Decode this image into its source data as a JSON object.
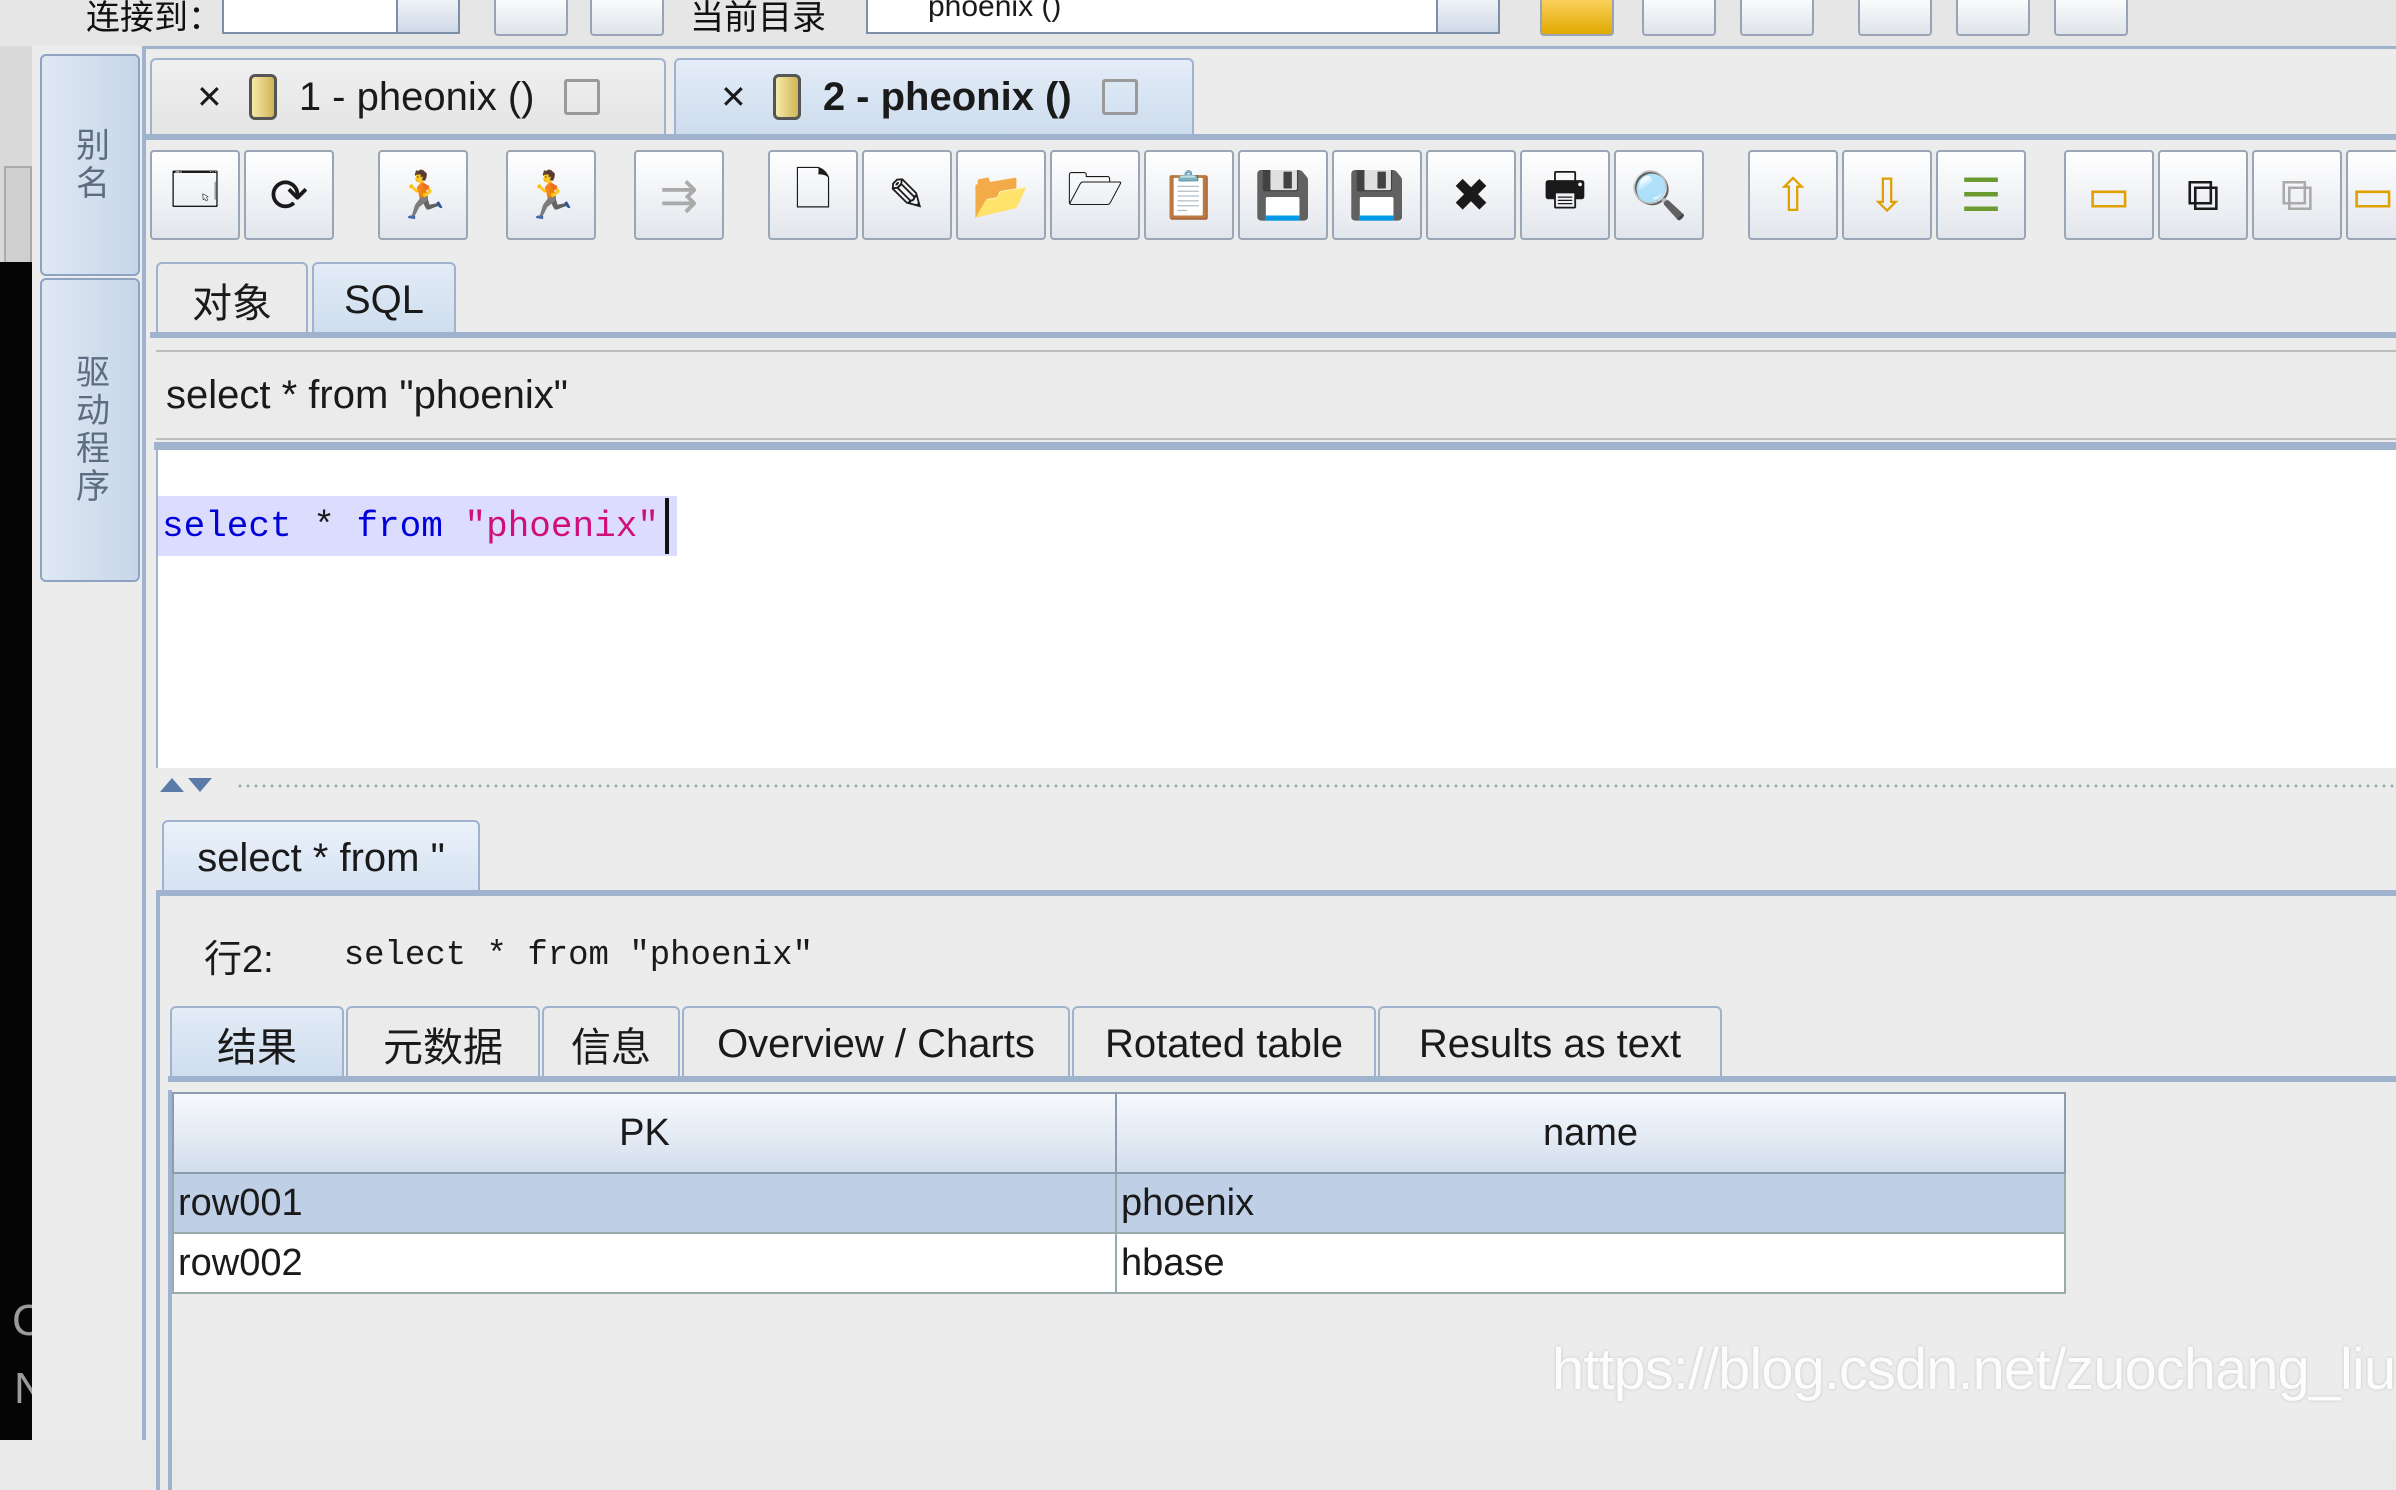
{
  "top_toolbar": {
    "label_left": "连接到：",
    "label_mid": "当前目录",
    "catalog_value": "phoenix ()"
  },
  "sidebar": {
    "tabs": [
      {
        "label": "别名"
      },
      {
        "label": "驱动程序"
      }
    ]
  },
  "connection_tabs": [
    {
      "label": "1 - pheonix ()",
      "active": false
    },
    {
      "label": "2 - pheonix ()",
      "active": true
    }
  ],
  "toolbar": {
    "icons": [
      "open-session-icon",
      "reconnect-icon",
      "run-sql-icon",
      "run-current-icon",
      "run-all-icon",
      "new-file-icon",
      "new-file-star-icon",
      "open-folder-icon",
      "recent-files-icon",
      "paste-icon",
      "save-icon",
      "save-as-icon",
      "delete-icon",
      "print-icon",
      "print-preview-icon",
      "up-arrow-icon",
      "down-arrow-icon",
      "list-icon",
      "toolbar-a-icon",
      "toolbar-b-icon",
      "toolbar-c-icon",
      "toolbar-d-icon"
    ]
  },
  "sub_tabs": [
    {
      "label": "对象",
      "active": false
    },
    {
      "label": "SQL",
      "active": true
    }
  ],
  "sql_history": {
    "value": "select * from \"phoenix\""
  },
  "editor": {
    "kw_select": "select",
    "star": "*",
    "kw_from": "from",
    "table": "\"phoenix\""
  },
  "result_tab": {
    "label": "select * from \""
  },
  "query_info": {
    "row_label": "行2:",
    "query": "select * from \"phoenix\""
  },
  "result_sub_tabs": [
    {
      "label": "结果",
      "active": true
    },
    {
      "label": "元数据",
      "active": false
    },
    {
      "label": "信息",
      "active": false
    },
    {
      "label": "Overview / Charts",
      "active": false
    },
    {
      "label": "Rotated table",
      "active": false
    },
    {
      "label": "Results as text",
      "active": false
    }
  ],
  "grid": {
    "columns": [
      "PK",
      "name"
    ],
    "rows": [
      [
        "row001",
        "phoenix"
      ],
      [
        "row002",
        "hbase"
      ]
    ]
  },
  "watermark": "https://blog.csdn.net/zuochang_liu",
  "left_strip": {
    "c": "C",
    "n": "N"
  },
  "colors": {
    "tab_border": "#9fb3cf",
    "selection_row": "#bfd0e6",
    "keyword": "#0000d8",
    "string": "#d0107a"
  }
}
